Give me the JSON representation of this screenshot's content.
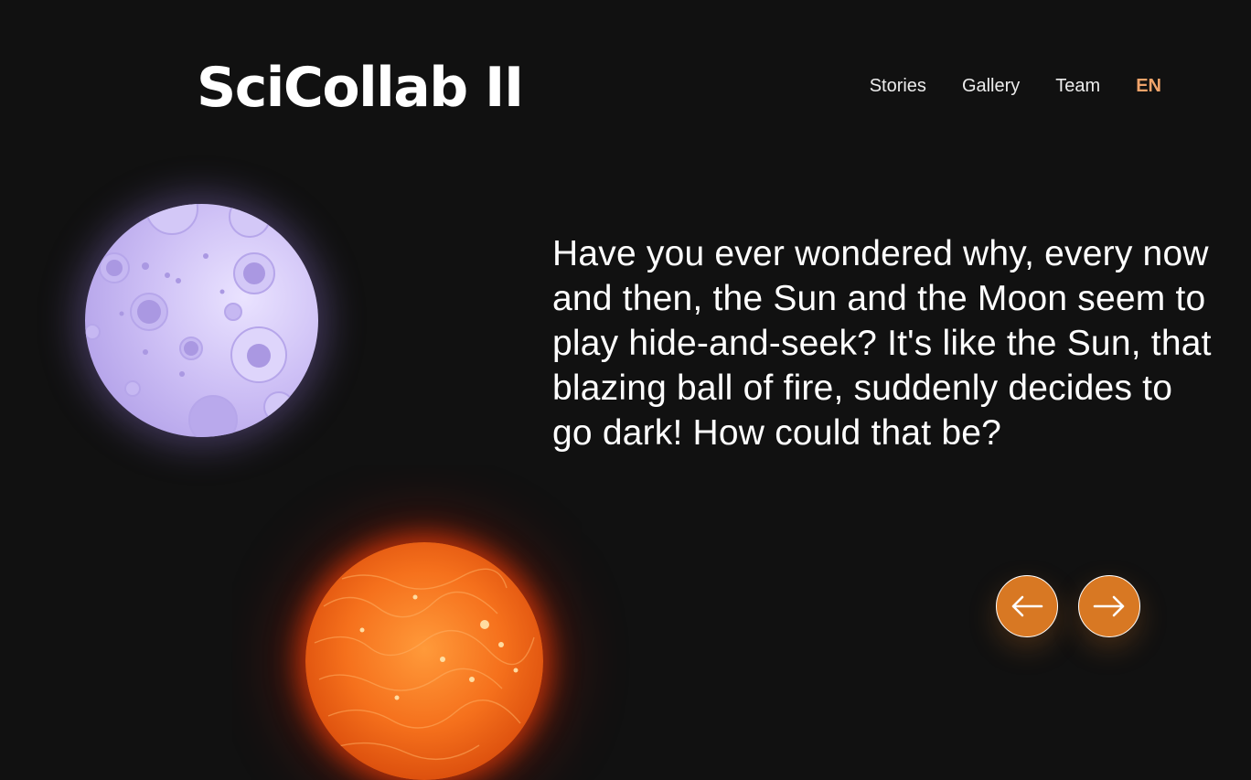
{
  "header": {
    "logo": "SciCollab II",
    "nav": {
      "stories": "Stories",
      "gallery": "Gallery",
      "team": "Team",
      "language": "EN"
    }
  },
  "story": {
    "text": "Have you ever wondered why, every now and then, the Sun and the Moon seem to play hide-and-seek? It's like the Sun, that blazing ball of fire, suddenly decides to go dark! How could that be?"
  },
  "controls": {
    "prev_icon": "arrow-left-icon",
    "next_icon": "arrow-right-icon"
  },
  "colors": {
    "background": "#111111",
    "accent": "#f0a36a",
    "button": "#d87823",
    "moon": "#cdbff5",
    "sun": "#f5701c"
  }
}
